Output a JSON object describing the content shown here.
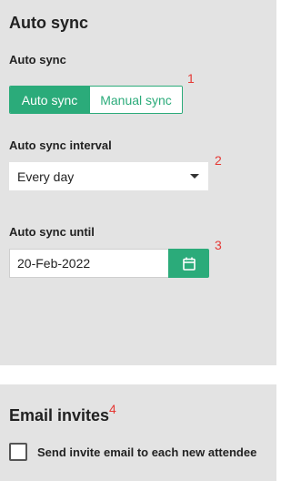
{
  "auto_sync_section": {
    "title": "Auto sync",
    "mode_label": "Auto sync",
    "mode_options": [
      "Auto sync",
      "Manual sync"
    ],
    "selected_mode": "Auto sync",
    "interval_label": "Auto sync interval",
    "interval_value": "Every day",
    "until_label": "Auto sync until",
    "until_value": "20-Feb-2022"
  },
  "email_invites_section": {
    "title": "Email invites",
    "send_invite_label": "Send invite email to each new attendee",
    "send_invite_checked": false
  },
  "annotation_markers": [
    "1",
    "2",
    "3",
    "4"
  ],
  "colors": {
    "accent": "#2bab7a",
    "panel_bg": "#e3e3e3",
    "marker": "#e53935"
  }
}
